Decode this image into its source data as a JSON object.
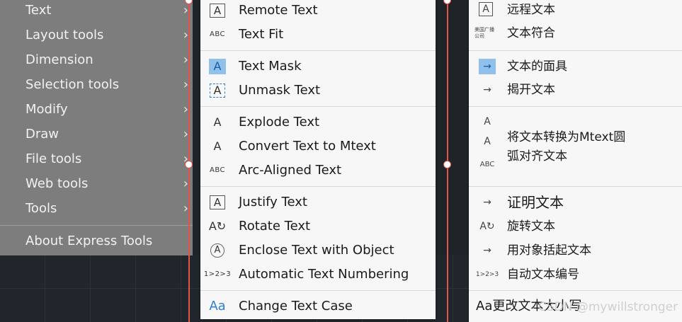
{
  "left_menu": {
    "items": [
      {
        "label": "Text"
      },
      {
        "label": "Layout tools"
      },
      {
        "label": "Dimension"
      },
      {
        "label": "Selection tools"
      },
      {
        "label": "Modify"
      },
      {
        "label": "Draw"
      },
      {
        "label": "File tools"
      },
      {
        "label": "Web tools"
      },
      {
        "label": "Tools"
      }
    ],
    "about": "About Express Tools",
    "arrow": "›"
  },
  "text_menu": {
    "items": [
      {
        "label": "Remote Text",
        "icon": "remote-text-icon",
        "glyph": "A"
      },
      {
        "label": "Text Fit",
        "icon": "text-fit-icon",
        "glyph": "ABC"
      },
      {
        "label": "Text Mask",
        "icon": "text-mask-icon",
        "glyph": "A"
      },
      {
        "label": "Unmask Text",
        "icon": "unmask-text-icon",
        "glyph": "A"
      },
      {
        "label": "Explode Text",
        "icon": "explode-text-icon",
        "glyph": "A"
      },
      {
        "label": "Convert Text to Mtext",
        "icon": "convert-text-icon",
        "glyph": "A"
      },
      {
        "label": "Arc-Aligned Text",
        "icon": "arc-text-icon",
        "glyph": "ABC"
      },
      {
        "label": "Justify Text",
        "icon": "justify-text-icon",
        "glyph": "A"
      },
      {
        "label": "Rotate Text",
        "icon": "rotate-text-icon",
        "glyph": "A↻"
      },
      {
        "label": "Enclose Text with Object",
        "icon": "enclose-text-icon",
        "glyph": "A"
      },
      {
        "label": "Automatic Text Numbering",
        "icon": "text-numbering-icon",
        "glyph": "1>2>3"
      },
      {
        "label": "Change Text Case",
        "icon": "change-case-icon",
        "glyph": "Aa"
      }
    ]
  },
  "cn_menu": {
    "items": [
      {
        "label": "远程文本",
        "icon": "remote-text-icon",
        "glyph": "A"
      },
      {
        "label": "文本符合",
        "icon": "text-fit-icon",
        "glyph": "美国广播 公司"
      },
      {
        "label": "文本的面具",
        "icon": "text-mask-icon",
        "glyph": "→"
      },
      {
        "label": "揭开文本",
        "icon": "unmask-text-icon",
        "glyph": "→"
      },
      {
        "label": "",
        "icon": "explode-text-icon",
        "glyph": "A"
      },
      {
        "label": "将文本转换为Mtext圆",
        "icon": "convert-text-icon",
        "glyph": "A"
      },
      {
        "label": "弧对齐文本",
        "icon": "arc-text-icon",
        "glyph": "ABC"
      },
      {
        "label": "证明文本",
        "icon": "justify-text-icon",
        "glyph": "→"
      },
      {
        "label": "旋转文本",
        "icon": "rotate-text-icon",
        "glyph": "A↻"
      },
      {
        "label": "用对象括起文本",
        "icon": "enclose-text-icon",
        "glyph": "→"
      },
      {
        "label": "自动文本编号",
        "icon": "text-numbering-icon",
        "glyph": "1>2>3"
      },
      {
        "label": "Aa更改文本大小写",
        "icon": "change-case-icon",
        "glyph": ""
      }
    ]
  },
  "watermark": "CSDN @mywillstronger",
  "colors": {
    "guide_line": "#e3534c",
    "menu_bg": "#f7f7f7",
    "left_menu_bg": "#7d7d7d",
    "accent_blue": "#2a7fd4"
  }
}
